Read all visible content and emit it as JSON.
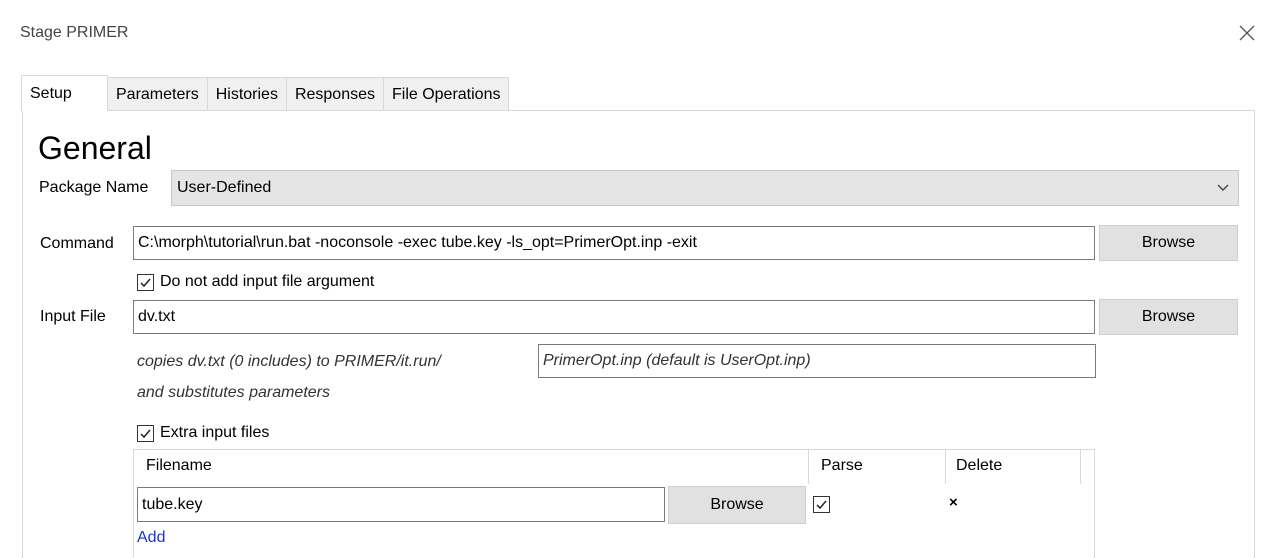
{
  "window": {
    "title": "Stage PRIMER",
    "close_icon": "close-icon"
  },
  "tabs": [
    {
      "label": "Setup",
      "active": true
    },
    {
      "label": "Parameters",
      "active": false
    },
    {
      "label": "Histories",
      "active": false
    },
    {
      "label": "Responses",
      "active": false
    },
    {
      "label": "File Operations",
      "active": false
    }
  ],
  "general": {
    "heading": "General",
    "package_label": "Package Name",
    "package_value": "User-Defined",
    "command_label": "Command",
    "command_value": "C:\\morph\\tutorial\\run.bat -noconsole -exec tube.key -ls_opt=PrimerOpt.inp -exit",
    "browse_label": "Browse",
    "no_input_arg_label": "Do not add input file argument",
    "no_input_arg_checked": true,
    "input_file_label": "Input File",
    "input_file_value": "dv.txt",
    "copies_line1": "copies dv.txt  (0 includes) to PRIMER/it.run/",
    "copies_line2": "and substitutes parameters",
    "output_name_value": " PrimerOpt.inp (default is UserOpt.inp)",
    "extra_files_label": "Extra input files",
    "extra_files_checked": true
  },
  "extra_files_table": {
    "columns": [
      "Filename",
      "Parse",
      "Delete"
    ],
    "rows": [
      {
        "filename": "tube.key",
        "browse": "Browse",
        "parse": true,
        "delete": "×"
      }
    ],
    "add_label": "Add"
  }
}
